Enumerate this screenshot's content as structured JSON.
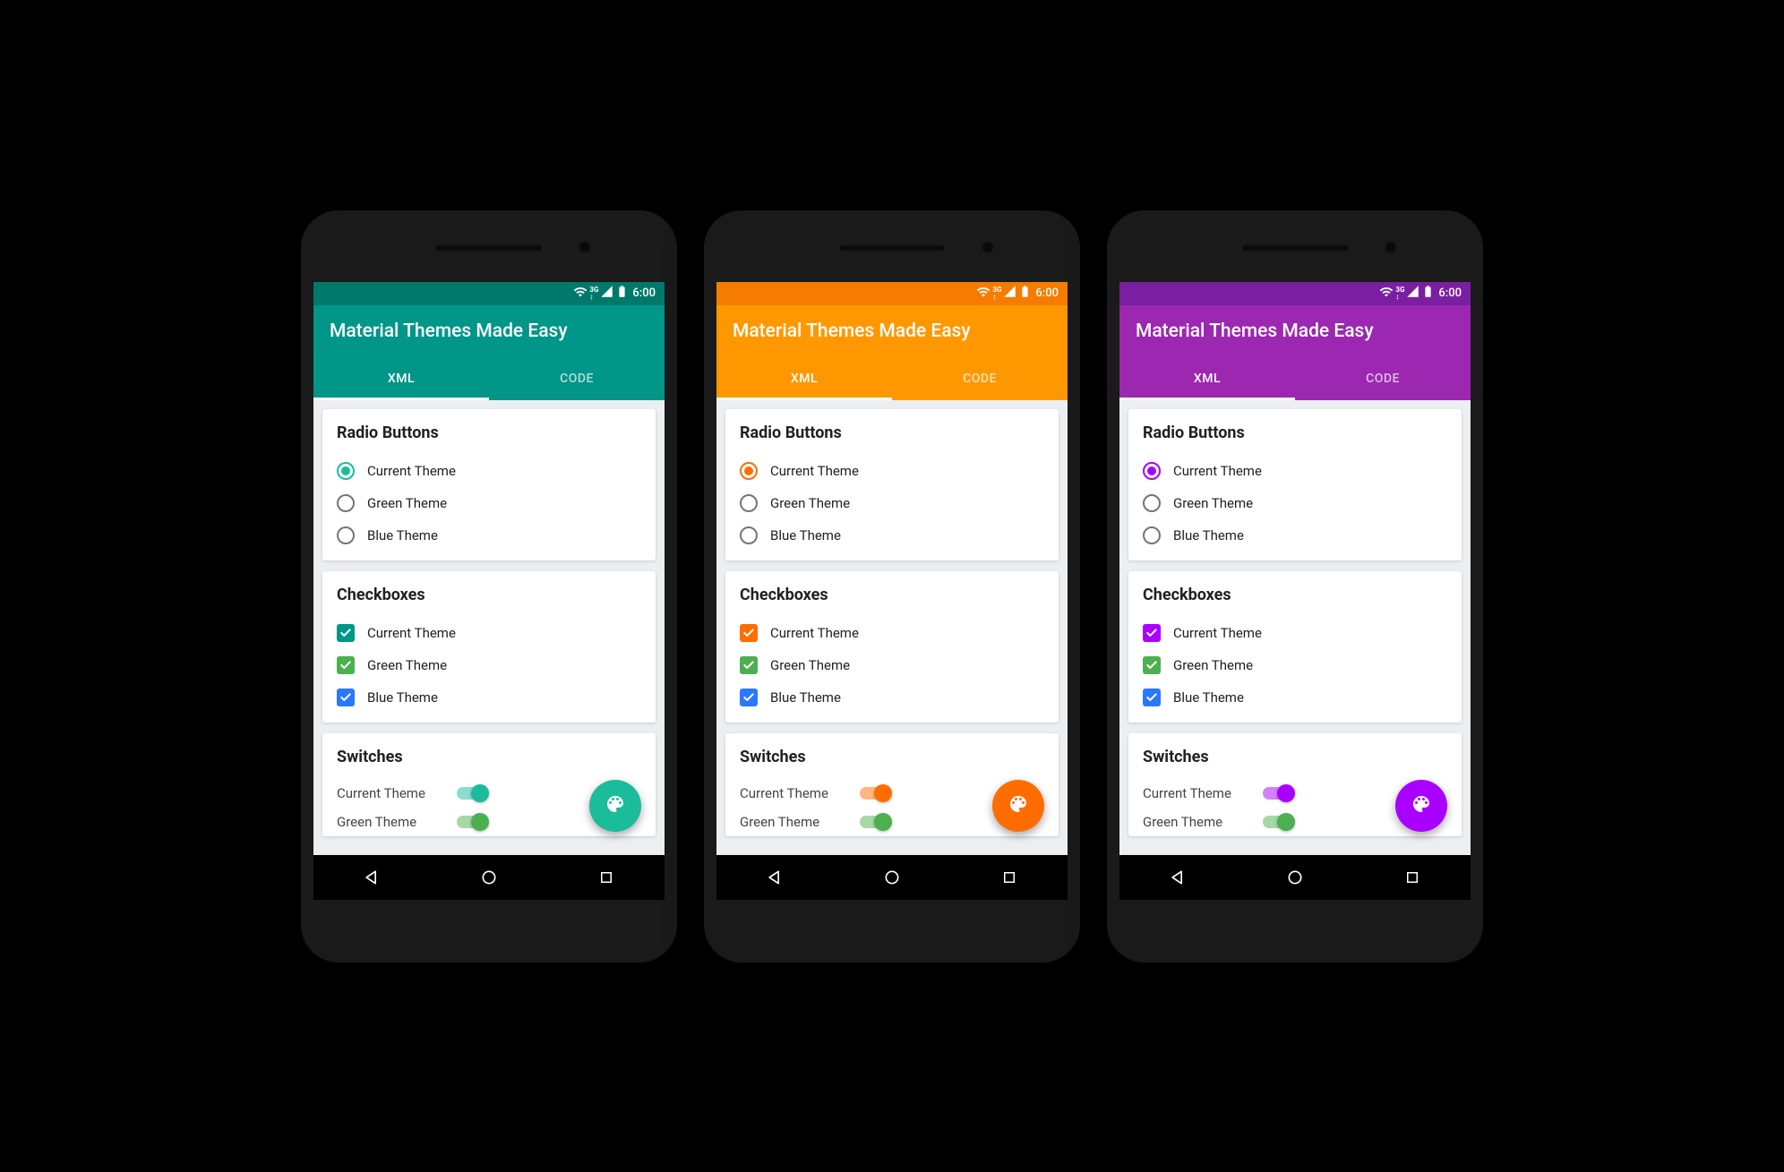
{
  "phones": [
    {
      "theme": {
        "primary": "#009688",
        "primaryDark": "#00796b",
        "accent": "#1abc9c"
      },
      "appbar_title": "Material Themes Made Easy",
      "status_time": "6:00",
      "tabs": [
        {
          "label": "XML",
          "active": true
        },
        {
          "label": "CODE",
          "active": false
        }
      ],
      "radio_heading": "Radio Buttons",
      "radios": [
        {
          "label": "Current Theme",
          "checked": true
        },
        {
          "label": "Green Theme",
          "checked": false
        },
        {
          "label": "Blue Theme",
          "checked": false
        }
      ],
      "checkbox_heading": "Checkboxes",
      "checkboxes": [
        {
          "label": "Current Theme",
          "color": "#009688"
        },
        {
          "label": "Green Theme",
          "color": "#4caf50"
        },
        {
          "label": "Blue Theme",
          "color": "#2979ff"
        }
      ],
      "switch_heading": "Switches",
      "switches": [
        {
          "label": "Current Theme",
          "color": "#1abc9c"
        },
        {
          "label": "Green Theme",
          "color": "#4caf50"
        }
      ]
    },
    {
      "theme": {
        "primary": "#ff9800",
        "primaryDark": "#f57c00",
        "accent": "#ff6d00"
      },
      "appbar_title": "Material Themes Made Easy",
      "status_time": "6:00",
      "tabs": [
        {
          "label": "XML",
          "active": true
        },
        {
          "label": "CODE",
          "active": false
        }
      ],
      "radio_heading": "Radio Buttons",
      "radios": [
        {
          "label": "Current Theme",
          "checked": true
        },
        {
          "label": "Green Theme",
          "checked": false
        },
        {
          "label": "Blue Theme",
          "checked": false
        }
      ],
      "checkbox_heading": "Checkboxes",
      "checkboxes": [
        {
          "label": "Current Theme",
          "color": "#ff6d00"
        },
        {
          "label": "Green Theme",
          "color": "#4caf50"
        },
        {
          "label": "Blue Theme",
          "color": "#2979ff"
        }
      ],
      "switch_heading": "Switches",
      "switches": [
        {
          "label": "Current Theme",
          "color": "#ff6d00"
        },
        {
          "label": "Green Theme",
          "color": "#4caf50"
        }
      ]
    },
    {
      "theme": {
        "primary": "#9c27b0",
        "primaryDark": "#7b1fa2",
        "accent": "#aa00ff"
      },
      "appbar_title": "Material Themes Made Easy",
      "status_time": "6:00",
      "tabs": [
        {
          "label": "XML",
          "active": true
        },
        {
          "label": "CODE",
          "active": false
        }
      ],
      "radio_heading": "Radio Buttons",
      "radios": [
        {
          "label": "Current Theme",
          "checked": true
        },
        {
          "label": "Green Theme",
          "checked": false
        },
        {
          "label": "Blue Theme",
          "checked": false
        }
      ],
      "checkbox_heading": "Checkboxes",
      "checkboxes": [
        {
          "label": "Current Theme",
          "color": "#aa00ff"
        },
        {
          "label": "Green Theme",
          "color": "#4caf50"
        },
        {
          "label": "Blue Theme",
          "color": "#2979ff"
        }
      ],
      "switch_heading": "Switches",
      "switches": [
        {
          "label": "Current Theme",
          "color": "#aa00ff"
        },
        {
          "label": "Green Theme",
          "color": "#4caf50"
        }
      ]
    }
  ]
}
